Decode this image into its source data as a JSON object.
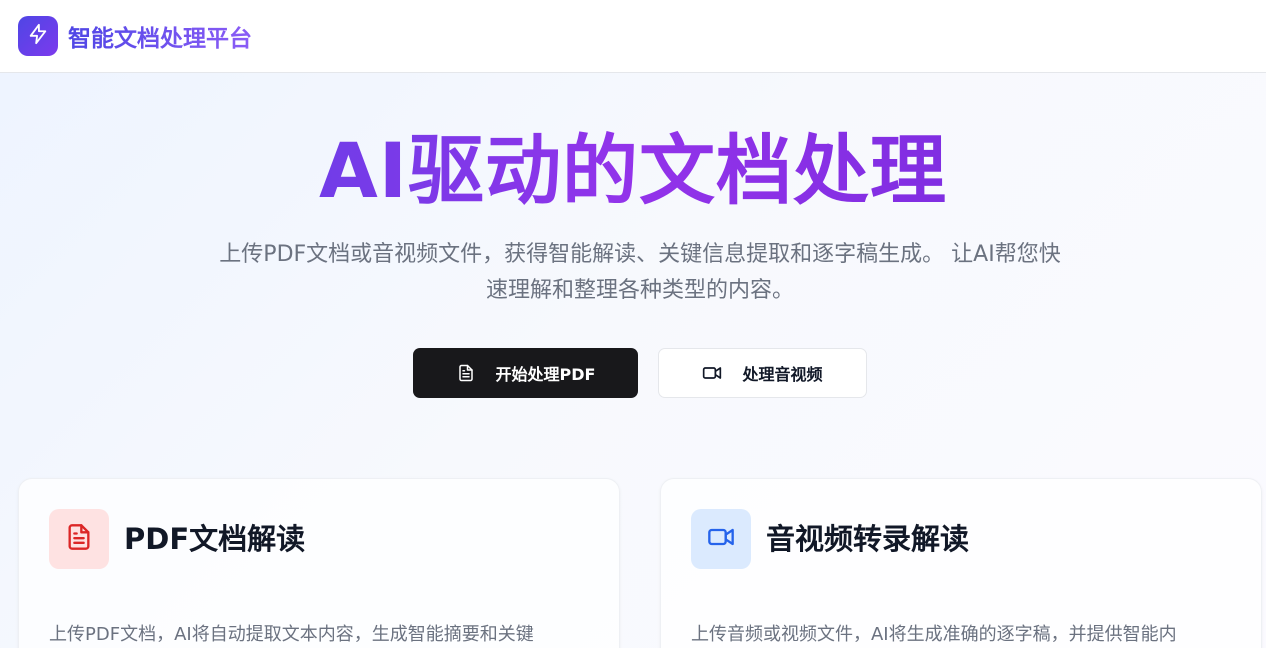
{
  "header": {
    "logo_icon": "lightning-bolt-icon",
    "brand_name": "智能文档处理平台"
  },
  "hero": {
    "title": "AI驱动的文档处理",
    "subtitle_line1": "上传PDF文档或音视频文件，获得智能解读、关键信息提取和逐字稿生成。 让AI帮您快",
    "subtitle_line2": "速理解和整理各种类型的内容。",
    "primary_button": {
      "label": "开始处理PDF",
      "icon": "document-icon"
    },
    "secondary_button": {
      "label": "处理音视频",
      "icon": "video-camera-icon"
    }
  },
  "features": [
    {
      "title": "PDF文档解读",
      "icon": "document-icon",
      "icon_color": "#dc2626",
      "icon_bg": "#fee2e2",
      "description": "上传PDF文档，AI将自动提取文本内容，生成智能摘要和关键"
    },
    {
      "title": "音视频转录解读",
      "icon": "video-camera-icon",
      "icon_color": "#2563eb",
      "icon_bg": "#dbeafe",
      "description": "上传音频或视频文件，AI将生成准确的逐字稿，并提供智能内"
    }
  ],
  "colors": {
    "brand_gradient_start": "#4f46e5",
    "brand_gradient_end": "#8b5cf6",
    "primary_button_bg": "#18181b"
  }
}
